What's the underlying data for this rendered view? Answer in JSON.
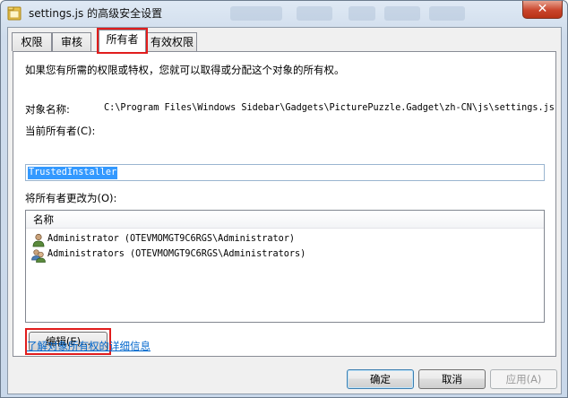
{
  "window": {
    "title": "settings.js 的高级安全设置",
    "close_glyph": "✕"
  },
  "tabs": [
    {
      "label": "权限",
      "active": false
    },
    {
      "label": "审核",
      "active": false
    },
    {
      "label": "所有者",
      "active": true
    },
    {
      "label": "有效权限",
      "active": false
    }
  ],
  "panel": {
    "intro": "如果您有所需的权限或特权，您就可以取得或分配这个对象的所有权。",
    "object_name_label": "对象名称:",
    "object_name_value": "C:\\Program Files\\Windows Sidebar\\Gadgets\\PicturePuzzle.Gadget\\zh-CN\\js\\settings.js",
    "current_owner_label": "当前所有者(C):",
    "current_owner_value": "TrustedInstaller",
    "change_owner_label": "将所有者更改为(O):",
    "list_header": "名称",
    "owners": [
      {
        "name": "Administrator (OTEVMOMGT9C6RGS\\Administrator)",
        "icon": "user-icon"
      },
      {
        "name": "Administrators (OTEVMOMGT9C6RGS\\Administrators)",
        "icon": "group-icon"
      }
    ],
    "edit_button": "编辑(E)..."
  },
  "learn_more_link": "了解对象所有权的详细信息",
  "buttons": {
    "ok": "确定",
    "cancel": "取消",
    "apply": "应用(A)"
  },
  "highlight_color": "#e11d1d",
  "selection_color": "#3399ff"
}
